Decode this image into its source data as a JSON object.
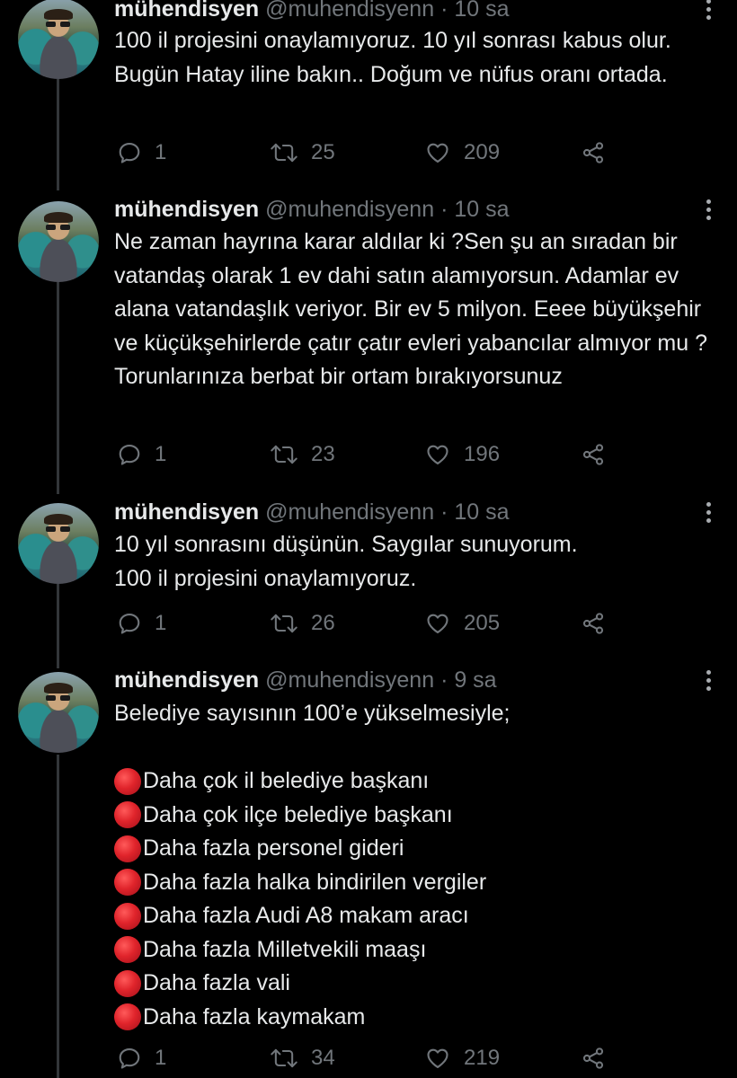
{
  "tweets": [
    {
      "name": "mühendisyen",
      "handle": "@muhendisyenn",
      "time": "· 10 sa",
      "text": "100 il projesini onaylamıyoruz. 10 yıl sonrası kabus olur. Bugün Hatay iline bakın.. Doğum ve nüfus oranı ortada.",
      "replies": "1",
      "retweets": "25",
      "likes": "209"
    },
    {
      "name": "mühendisyen",
      "handle": "@muhendisyenn",
      "time": "· 10 sa",
      "text": "Ne zaman hayrına karar aldılar ki ?Sen şu an sıradan bir vatandaş olarak 1 ev dahi satın alamıyorsun. Adamlar ev alana vatandaşlık veriyor. Bir ev 5 milyon. Eeee büyükşehir ve küçükşehirlerde çatır çatır evleri yabancılar almıyor mu ?Torunlarınıza berbat bir ortam bırakıyorsunuz",
      "replies": "1",
      "retweets": "23",
      "likes": "196"
    },
    {
      "name": "mühendisyen",
      "handle": "@muhendisyenn",
      "time": "· 10 sa",
      "text": "10 yıl sonrasını düşünün. Saygılar sunuyorum.\n100 il projesini onaylamıyoruz.",
      "replies": "1",
      "retweets": "26",
      "likes": "205"
    },
    {
      "name": "mühendisyen",
      "handle": "@muhendisyenn",
      "time": "· 9 sa",
      "text": "Belediye sayısının 100’e yükselmesiyle;",
      "list": [
        "Daha çok il belediye başkanı",
        "Daha çok ilçe belediye başkanı",
        "Daha fazla personel gideri",
        "Daha fazla halka bindirilen vergiler",
        "Daha fazla Audi A8 makam aracı",
        "Daha fazla Milletvekili maaşı",
        "Daha fazla vali",
        "Daha fazla kaymakam"
      ],
      "list_marker": "red-circle-emoji",
      "replies": "1",
      "retweets": "34",
      "likes": "219"
    }
  ],
  "icons": {
    "reply": "reply-icon",
    "retweet": "retweet-icon",
    "like": "heart-icon",
    "share": "share-icon",
    "more": "more-options-icon"
  },
  "colors": {
    "background": "#000000",
    "text": "#e7e9ea",
    "secondary": "#71767b",
    "thread_line": "#333639",
    "list_marker": "#e0242b"
  }
}
